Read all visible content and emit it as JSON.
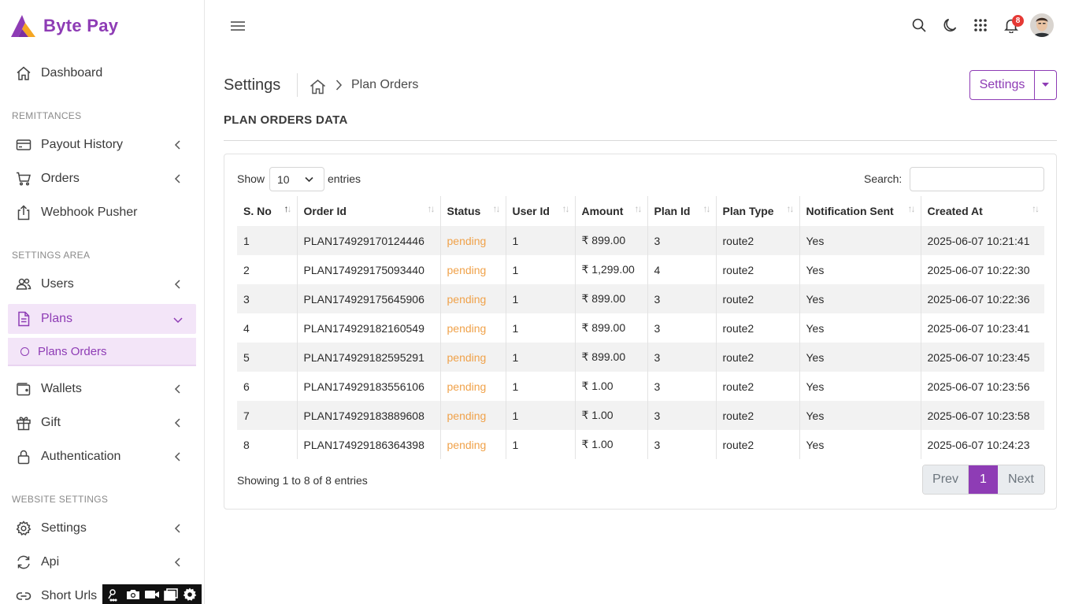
{
  "brand": {
    "name": "Byte Pay",
    "accent": "#8e3cb5"
  },
  "sidebar": {
    "dashboard": "Dashboard",
    "sections": [
      "REMITTANCES",
      "SETTINGS AREA",
      "WEBSITE SETTINGS"
    ],
    "items": [
      {
        "label": "Payout History",
        "icon": "card-icon"
      },
      {
        "label": "Orders",
        "icon": "cart-icon"
      },
      {
        "label": "Webhook Pusher",
        "icon": "upload-icon"
      },
      {
        "label": "Users",
        "icon": "users-icon"
      },
      {
        "label": "Plans",
        "icon": "document-icon"
      },
      {
        "label": "Wallets",
        "icon": "wallet-icon"
      },
      {
        "label": "Gift",
        "icon": "gift-icon"
      },
      {
        "label": "Authentication",
        "icon": "lock-icon"
      },
      {
        "label": "Settings",
        "icon": "gear-icon"
      },
      {
        "label": "Api",
        "icon": "refresh-icon"
      },
      {
        "label": "Short Urls",
        "icon": "link-icon"
      }
    ],
    "sub_item": "Plans Orders"
  },
  "header": {
    "notification_count": "8"
  },
  "page": {
    "title": "Settings",
    "breadcrumb_current": "Plan Orders",
    "settings_button": "Settings",
    "section_title": "PLAN ORDERS DATA"
  },
  "table_controls": {
    "show_label": "Show",
    "page_size": "10",
    "entries_label": "entries",
    "search_label": "Search:",
    "search_value": ""
  },
  "table": {
    "columns": [
      "S. No",
      "Order Id",
      "Status",
      "User Id",
      "Amount",
      "Plan Id",
      "Plan Type",
      "Notification Sent",
      "Created At"
    ],
    "rows": [
      [
        "1",
        "PLAN174929170124446",
        "pending",
        "1",
        "₹ 899.00",
        "3",
        "route2",
        "Yes",
        "2025-06-07 10:21:41"
      ],
      [
        "2",
        "PLAN174929175093440",
        "pending",
        "1",
        "₹ 1,299.00",
        "4",
        "route2",
        "Yes",
        "2025-06-07 10:22:30"
      ],
      [
        "3",
        "PLAN174929175645906",
        "pending",
        "1",
        "₹ 899.00",
        "3",
        "route2",
        "Yes",
        "2025-06-07 10:22:36"
      ],
      [
        "4",
        "PLAN174929182160549",
        "pending",
        "1",
        "₹ 899.00",
        "3",
        "route2",
        "Yes",
        "2025-06-07 10:23:41"
      ],
      [
        "5",
        "PLAN174929182595291",
        "pending",
        "1",
        "₹ 899.00",
        "3",
        "route2",
        "Yes",
        "2025-06-07 10:23:45"
      ],
      [
        "6",
        "PLAN174929183556106",
        "pending",
        "1",
        "₹ 1.00",
        "3",
        "route2",
        "Yes",
        "2025-06-07 10:23:56"
      ],
      [
        "7",
        "PLAN174929183889608",
        "pending",
        "1",
        "₹ 1.00",
        "3",
        "route2",
        "Yes",
        "2025-06-07 10:23:58"
      ],
      [
        "8",
        "PLAN174929186364398",
        "pending",
        "1",
        "₹ 1.00",
        "3",
        "route2",
        "Yes",
        "2025-06-07 10:24:23"
      ]
    ]
  },
  "footer": {
    "showing_text": "Showing 1 to 8 of 8 entries",
    "prev": "Prev",
    "current_page": "1",
    "next": "Next"
  }
}
